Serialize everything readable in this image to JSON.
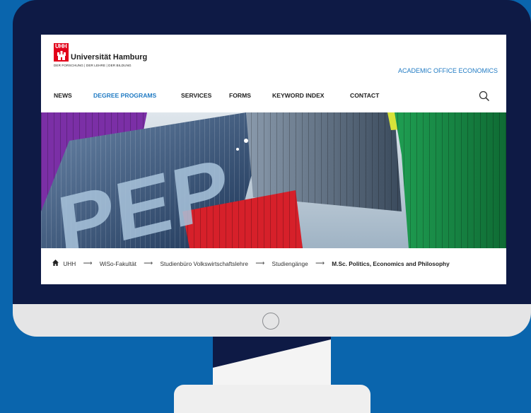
{
  "site": {
    "university_name": "Universität Hamburg",
    "tagline": "DER FORSCHUNG | DER LEHRE | DER BILDUNG",
    "logo_mark_text": "UHH",
    "office": "ACADEMIC OFFICE ECONOMICS"
  },
  "nav": {
    "items": [
      {
        "label": "NEWS",
        "active": false
      },
      {
        "label": "DEGREE PROGRAMS",
        "active": true
      },
      {
        "label": "SERVICES",
        "active": false
      },
      {
        "label": "FORMS",
        "active": false
      },
      {
        "label": "KEYWORD INDEX",
        "active": false
      },
      {
        "label": "CONTACT",
        "active": false
      }
    ],
    "search_icon": "search-icon"
  },
  "hero": {
    "lettering": "PEP",
    "description_icon": "shipping-containers-image"
  },
  "breadcrumb": {
    "items": [
      "UHH",
      "WiSo-Fakultät",
      "Studienbüro Volkswirtschaftslehre",
      "Studiengänge"
    ],
    "current": "M.Sc. Politics, Economics and Philosophy",
    "separator": "⟶",
    "home_icon": "home-icon"
  },
  "colors": {
    "background": "#0a65ad",
    "bezel": "#0e1a45",
    "accent": "#1f7ac3",
    "brand_red": "#e2001a"
  }
}
